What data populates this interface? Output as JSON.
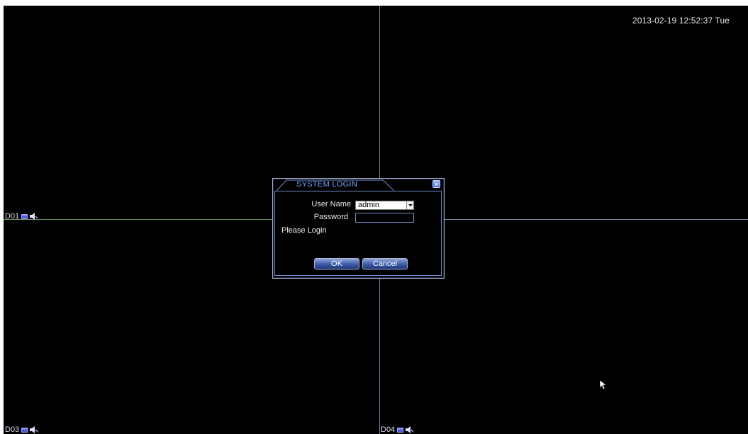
{
  "header": {
    "datetime": "2013-02-19 12:52:37 Tue"
  },
  "channels": [
    {
      "label": "D01"
    },
    {
      "label": "D03"
    },
    {
      "label": "D04"
    }
  ],
  "dialog": {
    "title": "SYSTEM LOGIN",
    "user_name_label": "User Name",
    "user_name_value": "admin",
    "password_label": "Password",
    "password_value": "",
    "status": "Please Login",
    "ok_label": "OK",
    "cancel_label": "Cancel"
  },
  "icons": {
    "record": "record-icon",
    "audio": "speaker-icon",
    "close": "close-icon",
    "dropdown": "chevron-down-icon",
    "cursor": "mouse-pointer-icon"
  },
  "colors": {
    "background": "#000000",
    "divider_green": "#5f8f5c",
    "divider_blue": "#7583a8",
    "dialog_accent": "#6fa8ff",
    "button_blue": "#3c5aa8"
  }
}
